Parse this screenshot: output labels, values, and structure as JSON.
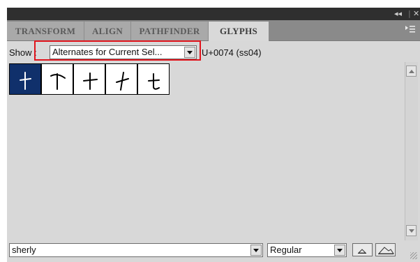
{
  "panel": {
    "titlebar": {
      "collapse_glyph": "◂◂",
      "close_glyph": "✕"
    },
    "tabs": [
      {
        "label": "TRANSFORM",
        "active": false
      },
      {
        "label": "ALIGN",
        "active": false
      },
      {
        "label": "PATHFINDER",
        "active": false
      },
      {
        "label": "GLYPHS",
        "active": true
      }
    ],
    "menu_icon": "panel-menu-icon"
  },
  "show": {
    "label": "Show :",
    "selected": "Alternates for Current Sel...",
    "code": "U+0074 (ss04)"
  },
  "glyphs": [
    {
      "name": "t-alt-1",
      "selected": true
    },
    {
      "name": "t-alt-2",
      "selected": false
    },
    {
      "name": "t-alt-3",
      "selected": false
    },
    {
      "name": "t-alt-4",
      "selected": false
    },
    {
      "name": "t-alt-5",
      "selected": false
    }
  ],
  "footer": {
    "font_family": "sherly",
    "font_style": "Regular",
    "zoom_out_icon": "small-mountain-icon",
    "zoom_in_icon": "large-mountain-icon"
  },
  "colors": {
    "selection": "#10306b",
    "highlight": "#e0141c",
    "panel_bg": "#d8d8d8"
  }
}
